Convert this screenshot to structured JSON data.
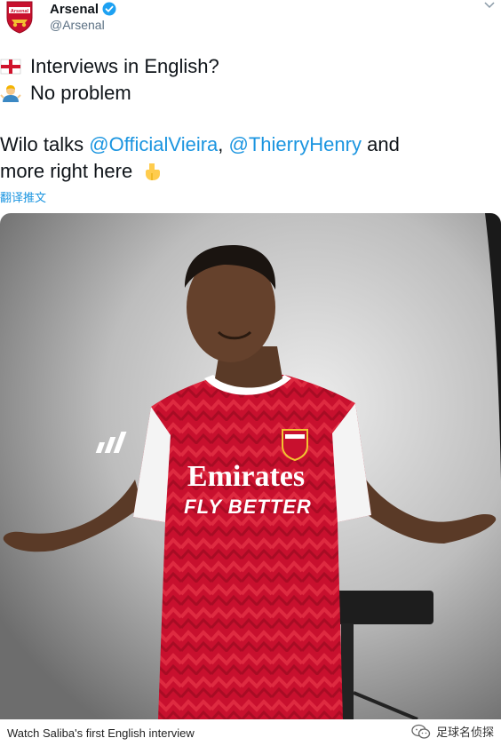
{
  "tweet": {
    "author": {
      "display_name": "Arsenal",
      "handle": "@Arsenal",
      "verified": true,
      "avatar_icon": "arsenal-crest-icon",
      "badge_text": "Arsenal"
    },
    "lines": {
      "line1_text": "Interviews in English?",
      "line2_text": "No problem",
      "line3_prefix": "Wilo talks ",
      "mention1": "@OfficialVieira",
      "separator": ", ",
      "mention2": "@ThierryHenry",
      "line3_suffix": " and",
      "line4_text": "more right here"
    },
    "emojis": [
      "england-flag-icon",
      "person-shrugging-icon",
      "pointing-down-icon"
    ],
    "translate_link": "翻译推文",
    "media": {
      "shirt_sponsor": "Emirates",
      "shirt_slogan": "FLY BETTER"
    }
  },
  "caption": "Watch Saliba's first English interview",
  "watermark": {
    "text": "足球名侦探",
    "icon": "wechat-icon"
  },
  "colors": {
    "link": "#1b95e0",
    "text": "#0f1419",
    "muted": "#5b7083",
    "kit_red": "#c8102e"
  }
}
